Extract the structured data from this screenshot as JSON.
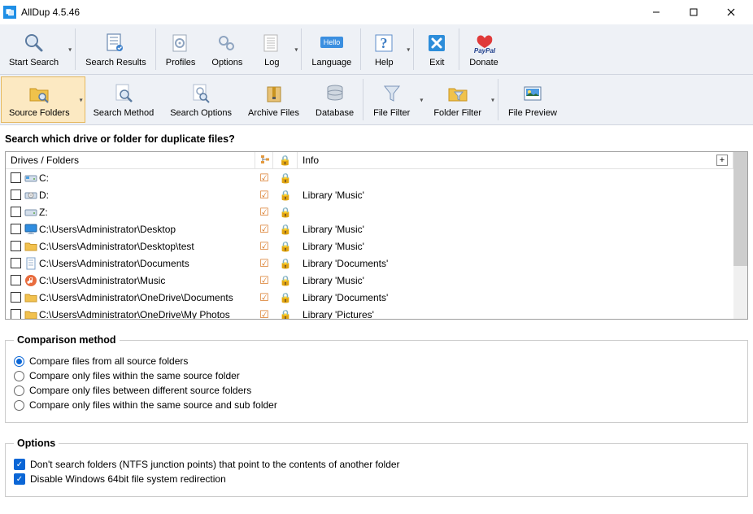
{
  "titlebar": {
    "title": "AllDup 4.5.46"
  },
  "toolbar1": {
    "start_search": "Start Search",
    "search_results": "Search Results",
    "profiles": "Profiles",
    "options": "Options",
    "log": "Log",
    "language": "Language",
    "help": "Help",
    "exit": "Exit",
    "donate": "Donate",
    "hello": "Hello"
  },
  "toolbar2": {
    "source_folders": "Source Folders",
    "search_method": "Search Method",
    "search_options": "Search Options",
    "archive_files": "Archive Files",
    "database": "Database",
    "file_filter": "File Filter",
    "folder_filter": "Folder Filter",
    "file_preview": "File Preview"
  },
  "heading": "Search which drive or folder for duplicate files?",
  "cols": {
    "drives": "Drives / Folders",
    "info": "Info"
  },
  "rows": [
    {
      "path": "C:",
      "info": "",
      "icon": "drive-sys"
    },
    {
      "path": "D:",
      "info": "Library 'Music'",
      "icon": "drive-cd"
    },
    {
      "path": "Z:",
      "info": "",
      "icon": "drive"
    },
    {
      "path": "C:\\Users\\Administrator\\Desktop",
      "info": "Library 'Music'",
      "icon": "monitor"
    },
    {
      "path": "C:\\Users\\Administrator\\Desktop\\test",
      "info": "Library 'Music'",
      "icon": "folder"
    },
    {
      "path": "C:\\Users\\Administrator\\Documents",
      "info": "Library 'Documents'",
      "icon": "doc"
    },
    {
      "path": "C:\\Users\\Administrator\\Music",
      "info": "Library 'Music'",
      "icon": "music"
    },
    {
      "path": "C:\\Users\\Administrator\\OneDrive\\Documents",
      "info": "Library 'Documents'",
      "icon": "folder"
    },
    {
      "path": "C:\\Users\\Administrator\\OneDrive\\My Photos",
      "info": "Library 'Pictures'",
      "icon": "folder"
    }
  ],
  "comparison": {
    "legend": "Comparison method",
    "opt1": "Compare files from all source folders",
    "opt2": "Compare only files within the same source folder",
    "opt3": "Compare only files between different source folders",
    "opt4": "Compare only files within the same source and sub folder"
  },
  "options": {
    "legend": "Options",
    "opt1": "Don't search folders (NTFS junction points) that point to the contents of another folder",
    "opt2": "Disable Windows 64bit file system redirection"
  }
}
